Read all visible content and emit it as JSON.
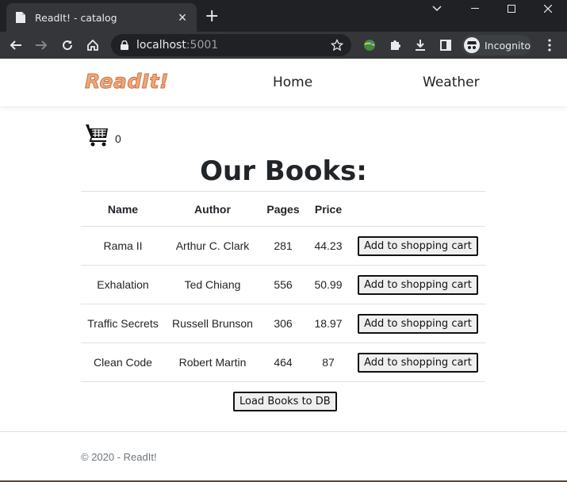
{
  "browser": {
    "tab_title": "ReadIt! - catalog",
    "url_host": "localhost",
    "url_port": ":5001",
    "incognito_label": "Incognito"
  },
  "navbar": {
    "brand": "ReadIt!",
    "links": [
      "Home",
      "Weather"
    ]
  },
  "cart": {
    "count": "0"
  },
  "page": {
    "heading": "Our Books:",
    "load_button": "Load Books to DB",
    "footer": "© 2020 - ReadIt!"
  },
  "table": {
    "headers": [
      "Name",
      "Author",
      "Pages",
      "Price"
    ],
    "action_label": "Add to shopping cart",
    "rows": [
      {
        "name": "Rama II",
        "author": "Arthur C. Clark",
        "pages": "281",
        "price": "44.23"
      },
      {
        "name": "Exhalation",
        "author": "Ted Chiang",
        "pages": "556",
        "price": "50.99"
      },
      {
        "name": "Traffic Secrets",
        "author": "Russell Brunson",
        "pages": "306",
        "price": "18.97"
      },
      {
        "name": "Clean Code",
        "author": "Robert Martin",
        "pages": "464",
        "price": "87"
      }
    ]
  },
  "colors": {
    "brand": "#f0a876",
    "browser_frame": "#202124",
    "toolbar": "#35363a"
  }
}
